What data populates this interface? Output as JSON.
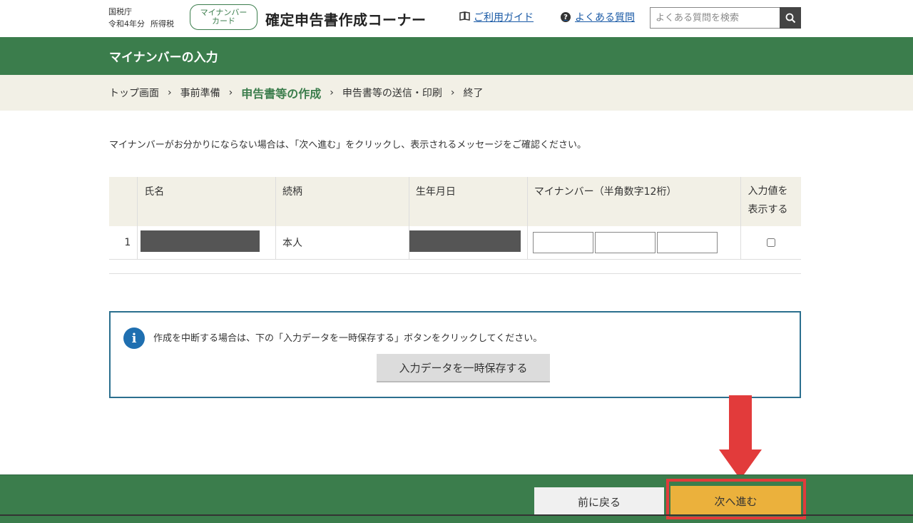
{
  "header": {
    "agency": "国税庁",
    "year": "令和4年分",
    "category": "所得税",
    "mynumber_card_line1": "マイナンバー",
    "mynumber_card_line2": "カード",
    "site_title": "確定申告書作成コーナー",
    "guide_link": "ご利用ガイド",
    "faq_link": "よくある質問",
    "search_placeholder": "よくある質問を検索"
  },
  "page_title": "マイナンバーの入力",
  "steps": [
    {
      "label": "トップ画面",
      "current": false
    },
    {
      "label": "事前準備",
      "current": false
    },
    {
      "label": "申告書等の作成",
      "current": true
    },
    {
      "label": "申告書等の送信・印刷",
      "current": false
    },
    {
      "label": "終了",
      "current": false
    }
  ],
  "instruction": "マイナンバーがお分かりにならない場合は、「次へ進む」をクリックし、表示されるメッセージをご確認ください。",
  "table": {
    "headers": {
      "name": "氏名",
      "relation": "続柄",
      "birthdate": "生年月日",
      "mynumber": "マイナンバー（半角数字12桁）",
      "show_value_line1": "入力値を",
      "show_value_line2": "表示する"
    },
    "rows": [
      {
        "index": "1",
        "relation": "本人"
      }
    ]
  },
  "info": {
    "text": "作成を中断する場合は、下の「入力データを一時保存する」ボタンをクリックしてください。",
    "save_button": "入力データを一時保存する"
  },
  "footer": {
    "back_button": "前に戻る",
    "next_button": "次へ進む"
  },
  "colors": {
    "brand_green": "#3b7d4c",
    "next_button": "#ebb13c",
    "highlight_red": "#e23b3b"
  }
}
